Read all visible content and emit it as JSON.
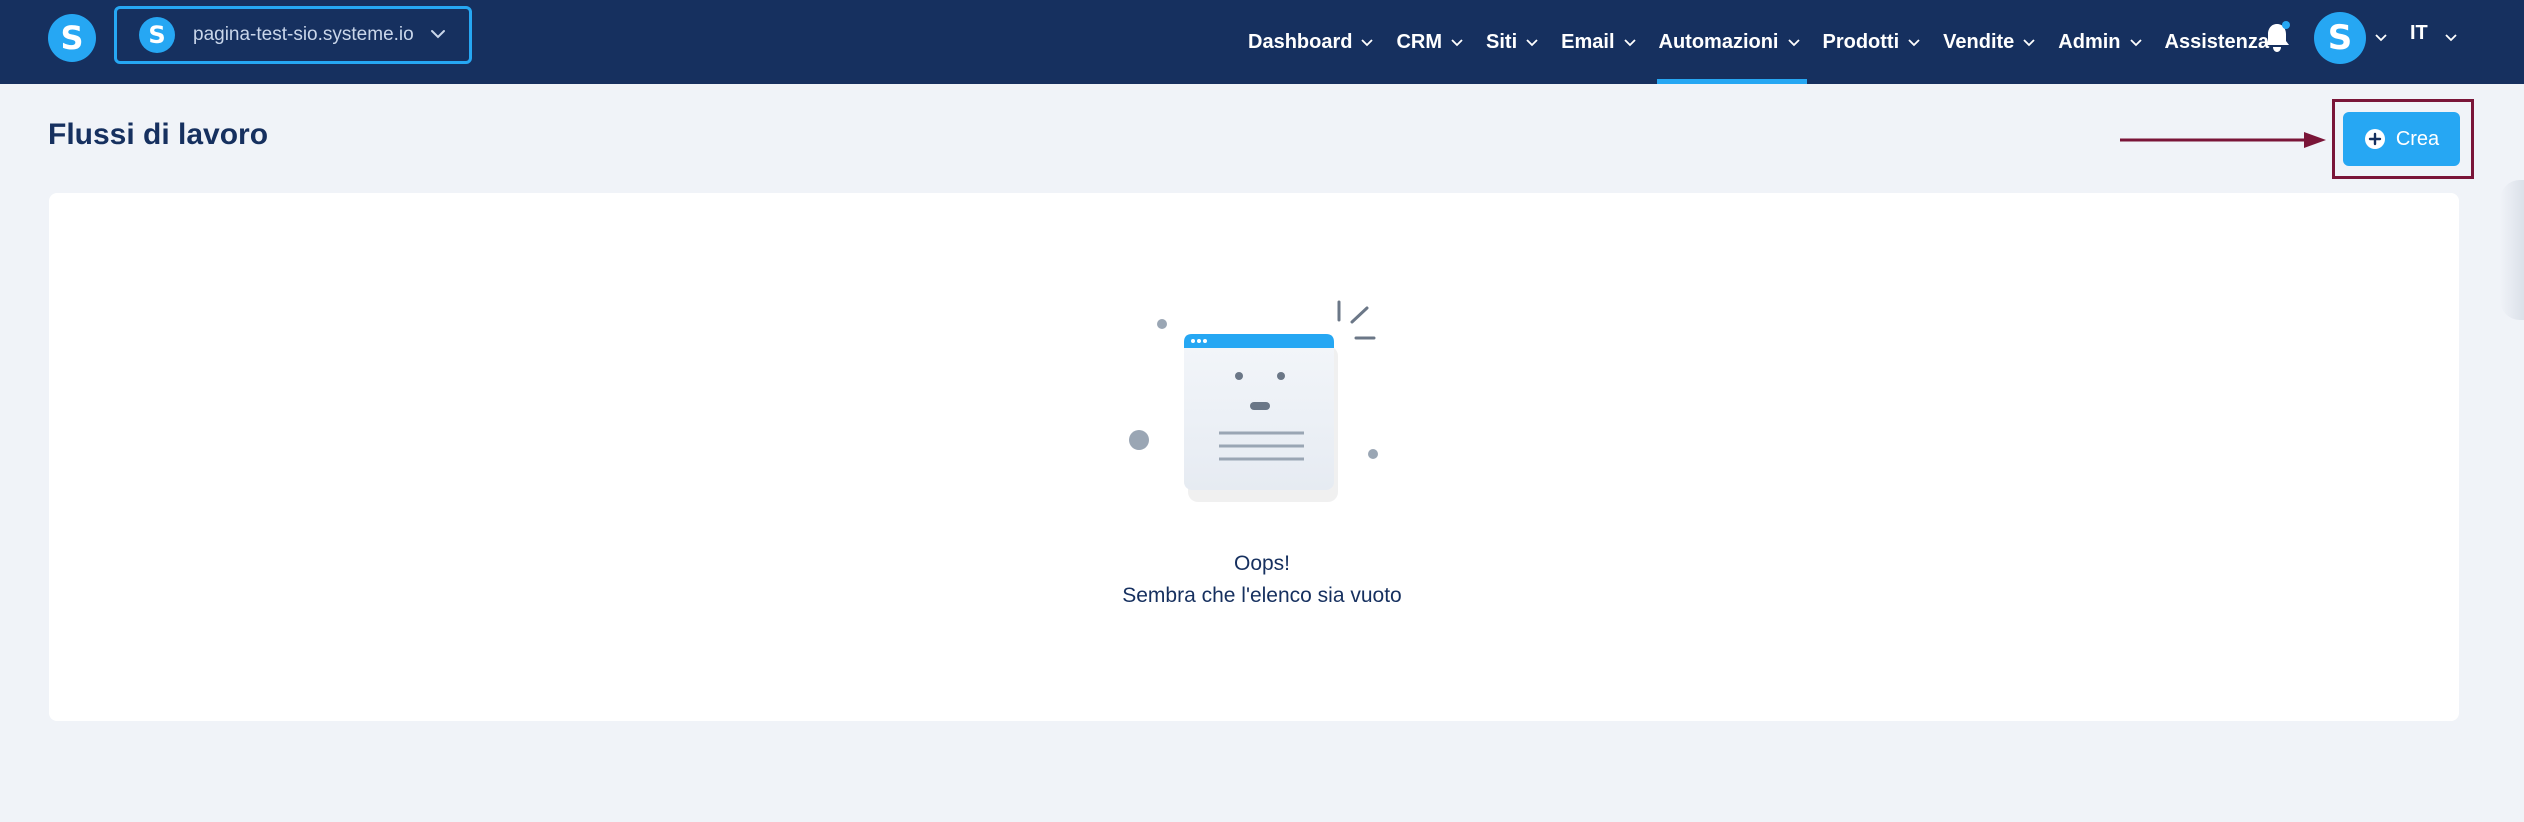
{
  "brand": {
    "logo_letter": "S",
    "accent": "#26a7f3",
    "navbar_bg": "#16305f"
  },
  "site_selector": {
    "logo_letter": "S",
    "name": "pagina-test-sio.systeme.io"
  },
  "nav": {
    "items": [
      {
        "label": "Dashboard",
        "dropdown": true,
        "active": false
      },
      {
        "label": "CRM",
        "dropdown": true,
        "active": false
      },
      {
        "label": "Siti",
        "dropdown": true,
        "active": false
      },
      {
        "label": "Email",
        "dropdown": true,
        "active": false
      },
      {
        "label": "Automazioni",
        "dropdown": true,
        "active": true
      },
      {
        "label": "Prodotti",
        "dropdown": true,
        "active": false
      },
      {
        "label": "Vendite",
        "dropdown": true,
        "active": false
      },
      {
        "label": "Admin",
        "dropdown": true,
        "active": false
      },
      {
        "label": "Assistenza",
        "dropdown": false,
        "active": false
      }
    ],
    "notification_icon": "bell-icon",
    "avatar_letter": "S",
    "language": "IT"
  },
  "page": {
    "title": "Flussi di lavoro",
    "create_button": {
      "label": "Crea",
      "icon": "plus-circle-icon"
    }
  },
  "empty_state": {
    "title": "Oops!",
    "message": "Sembra che l'elenco sia vuoto",
    "illustration": "empty-list-illustration"
  },
  "annotation": {
    "color": "#7a1538"
  }
}
